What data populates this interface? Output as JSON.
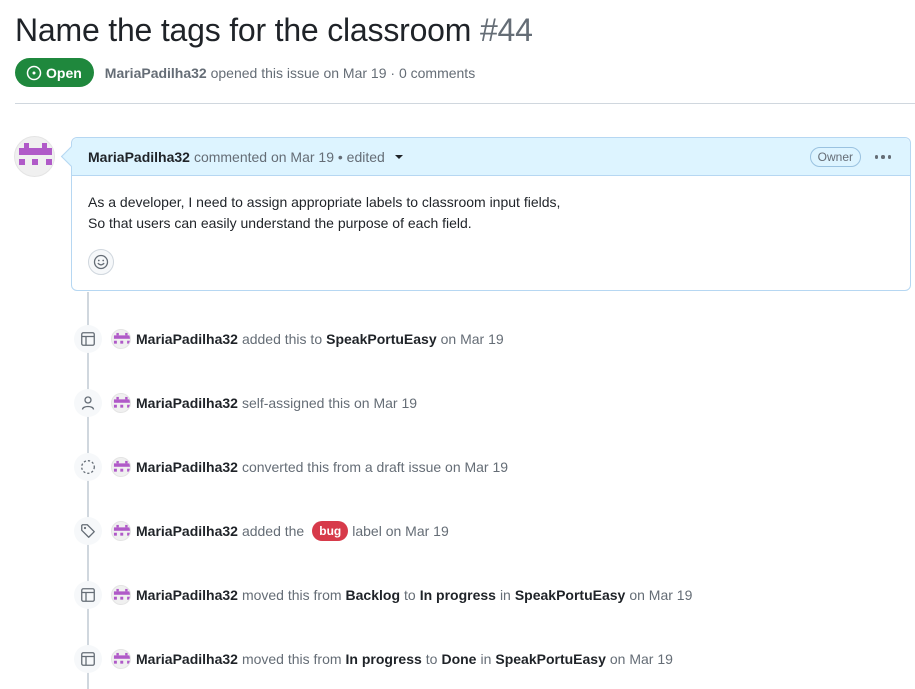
{
  "issue": {
    "title": "Name the tags for the classroom",
    "number": "#44",
    "state": "Open",
    "author": "MariaPadilha32",
    "meta": "opened this issue on Mar 19 · 0 comments"
  },
  "comment": {
    "author": "MariaPadilha32",
    "action": "commented on Mar 19 • edited",
    "role_badge": "Owner",
    "body_line1": "As a developer, I need to assign appropriate labels to classroom input fields,",
    "body_line2": "So that users can easily understand the purpose of each field."
  },
  "events": [
    {
      "icon": "project-icon",
      "actor": "MariaPadilha32",
      "t1": "added this to",
      "b1": "SpeakPortuEasy",
      "t2": "on Mar 19"
    },
    {
      "icon": "person-icon",
      "actor": "MariaPadilha32",
      "t1": "self-assigned this on Mar 19"
    },
    {
      "icon": "draft-issue-icon",
      "actor": "MariaPadilha32",
      "t1": "converted this from a draft issue on Mar 19"
    },
    {
      "icon": "tag-icon",
      "actor": "MariaPadilha32",
      "t1": "added the",
      "label": "bug",
      "t2": "label on Mar 19"
    },
    {
      "icon": "project-icon",
      "actor": "MariaPadilha32",
      "t1": "moved this from",
      "b1": "Backlog",
      "t2": "to",
      "b2": "In progress",
      "t3": "in",
      "b3": "SpeakPortuEasy",
      "t4": "on Mar 19"
    },
    {
      "icon": "project-icon",
      "actor": "MariaPadilha32",
      "t1": "moved this from",
      "b1": "In progress",
      "t2": "to",
      "b2": "Done",
      "t3": "in",
      "b3": "SpeakPortuEasy",
      "t4": "on Mar 19"
    }
  ],
  "colors": {
    "open_green": "#1f883d",
    "bug_label": "#d73a4a",
    "comment_header": "#ddf4ff",
    "avatar_purple": "#b05ac8"
  }
}
